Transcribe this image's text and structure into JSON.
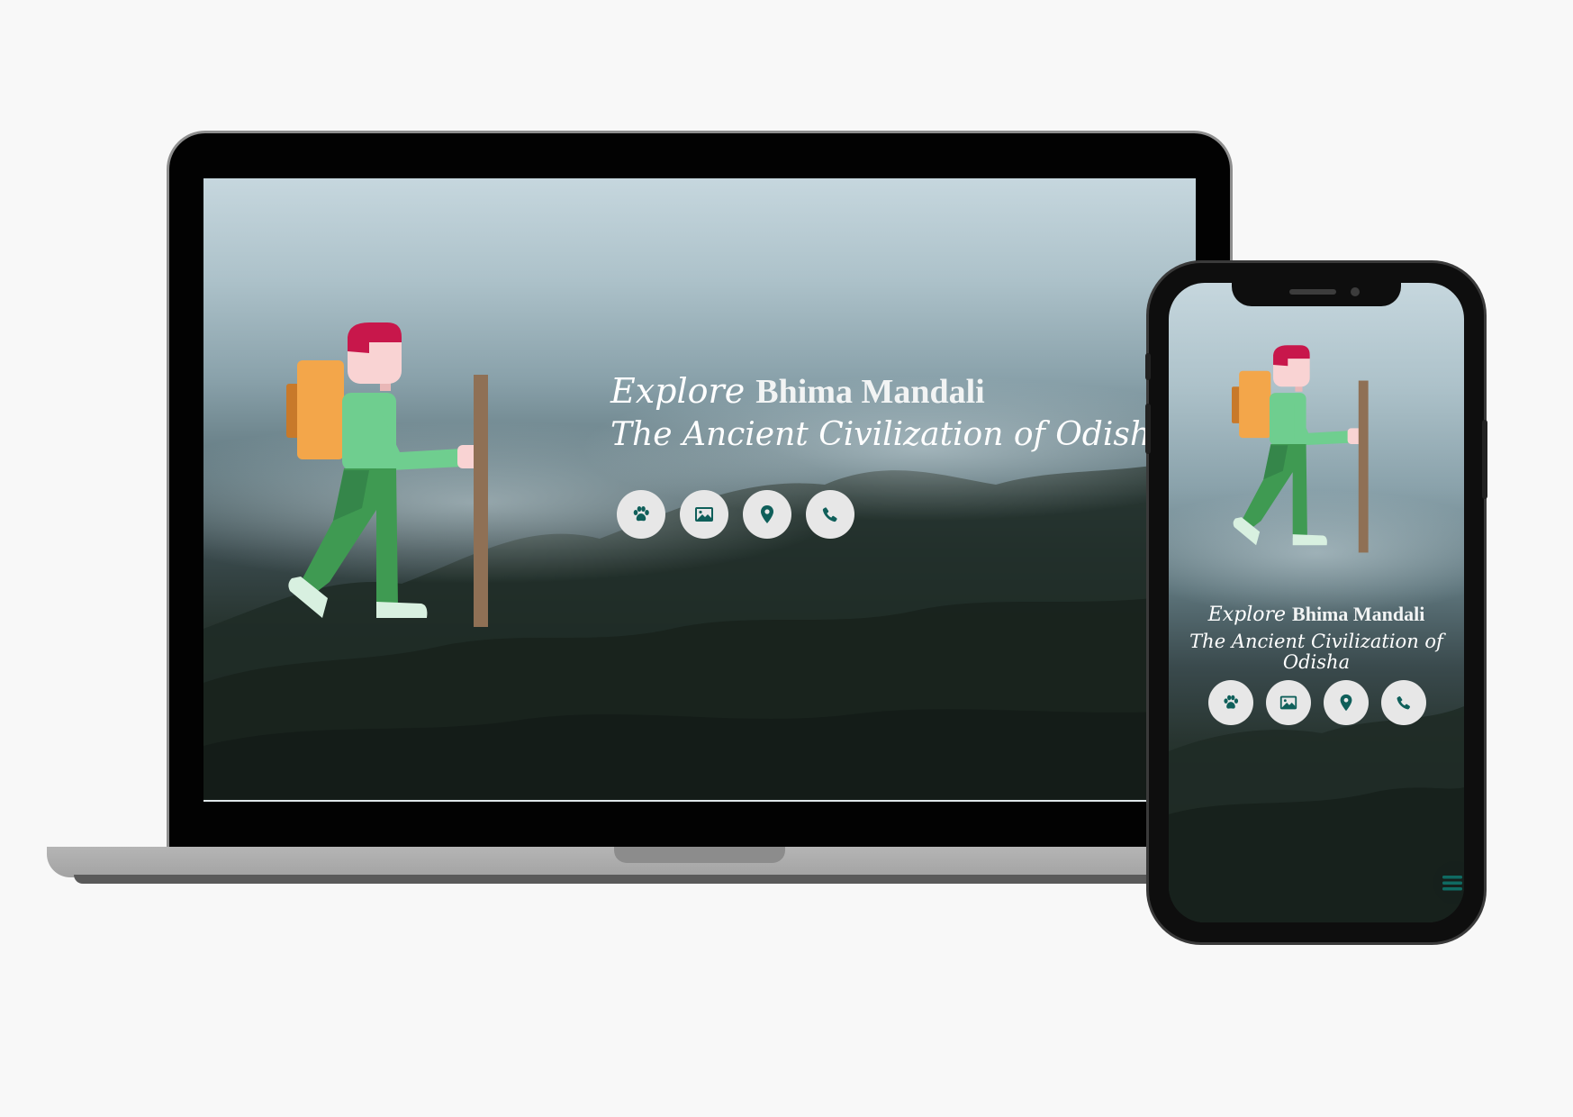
{
  "hero": {
    "explore_prefix": "Explore",
    "place_name": "Bhima Mandali",
    "tagline": "The Ancient Civilization of Odisha"
  },
  "icons": [
    {
      "name": "paw-icon",
      "label": "Wildlife"
    },
    {
      "name": "image-icon",
      "label": "Gallery"
    },
    {
      "name": "map-pin-icon",
      "label": "Location"
    },
    {
      "name": "phone-icon",
      "label": "Contact"
    }
  ],
  "colors": {
    "icon_color": "#0f5f5a",
    "icon_button_bg": "#e7e7e7",
    "hair": "#c8174b",
    "skin": "#f9d3d3",
    "shirt": "#6fce8f",
    "pants": "#3f9a52",
    "backpack": "#f3a64a",
    "stick": "#8f7055",
    "menu_icon": "#0f6a62"
  }
}
